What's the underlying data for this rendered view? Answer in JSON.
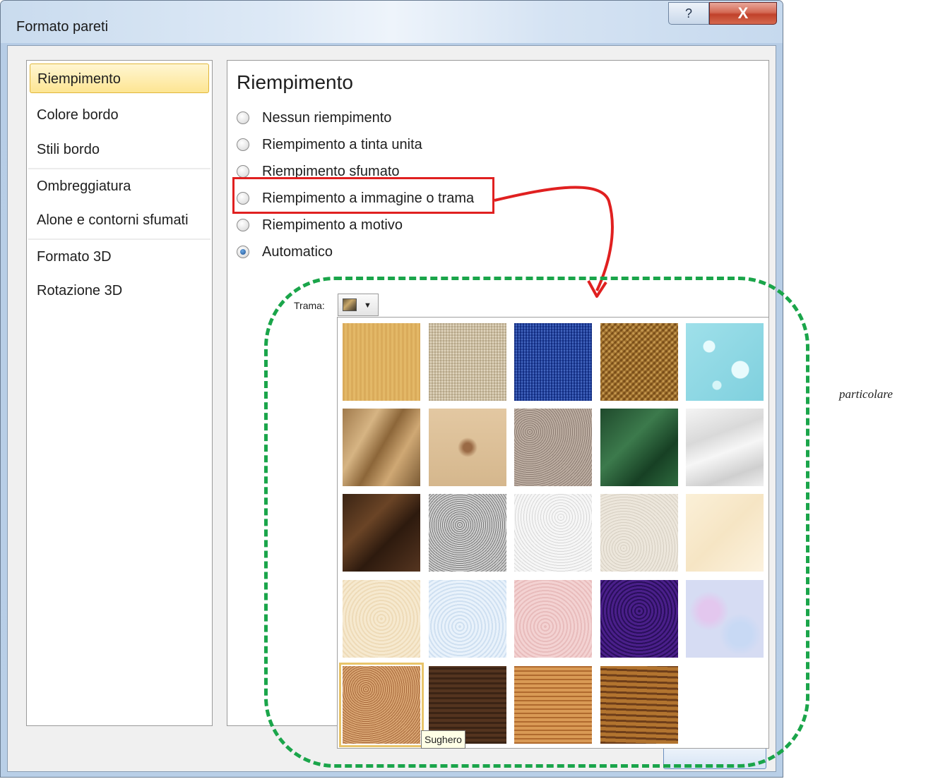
{
  "window": {
    "title": "Formato pareti",
    "help_glyph": "?",
    "close_glyph": "X"
  },
  "nav": {
    "items": [
      {
        "label": "Riempimento",
        "selected": true
      },
      {
        "label": "Colore bordo"
      },
      {
        "label": "Stili bordo"
      },
      {
        "label": "Ombreggiatura"
      },
      {
        "label": "Alone e contorni sfumati"
      },
      {
        "label": "Formato 3D"
      },
      {
        "label": "Rotazione 3D"
      }
    ]
  },
  "panel": {
    "title": "Riempimento",
    "options": [
      {
        "label": "Nessun riempimento",
        "checked": false
      },
      {
        "label": "Riempimento a tinta unita",
        "checked": false
      },
      {
        "label": "Riempimento sfumato",
        "checked": false
      },
      {
        "label": "Riempimento a immagine o trama",
        "checked": false,
        "highlighted": true
      },
      {
        "label": "Riempimento a motivo",
        "checked": false
      },
      {
        "label": "Automatico",
        "checked": true
      }
    ]
  },
  "texture": {
    "label": "Trama:",
    "tooltip": "Sughero",
    "selected": "Sughero"
  },
  "caption": "particolare",
  "colors": {
    "highlight_box": "#e02020",
    "dashed_outline": "#1aa54a",
    "nav_selected": "#fde592"
  }
}
